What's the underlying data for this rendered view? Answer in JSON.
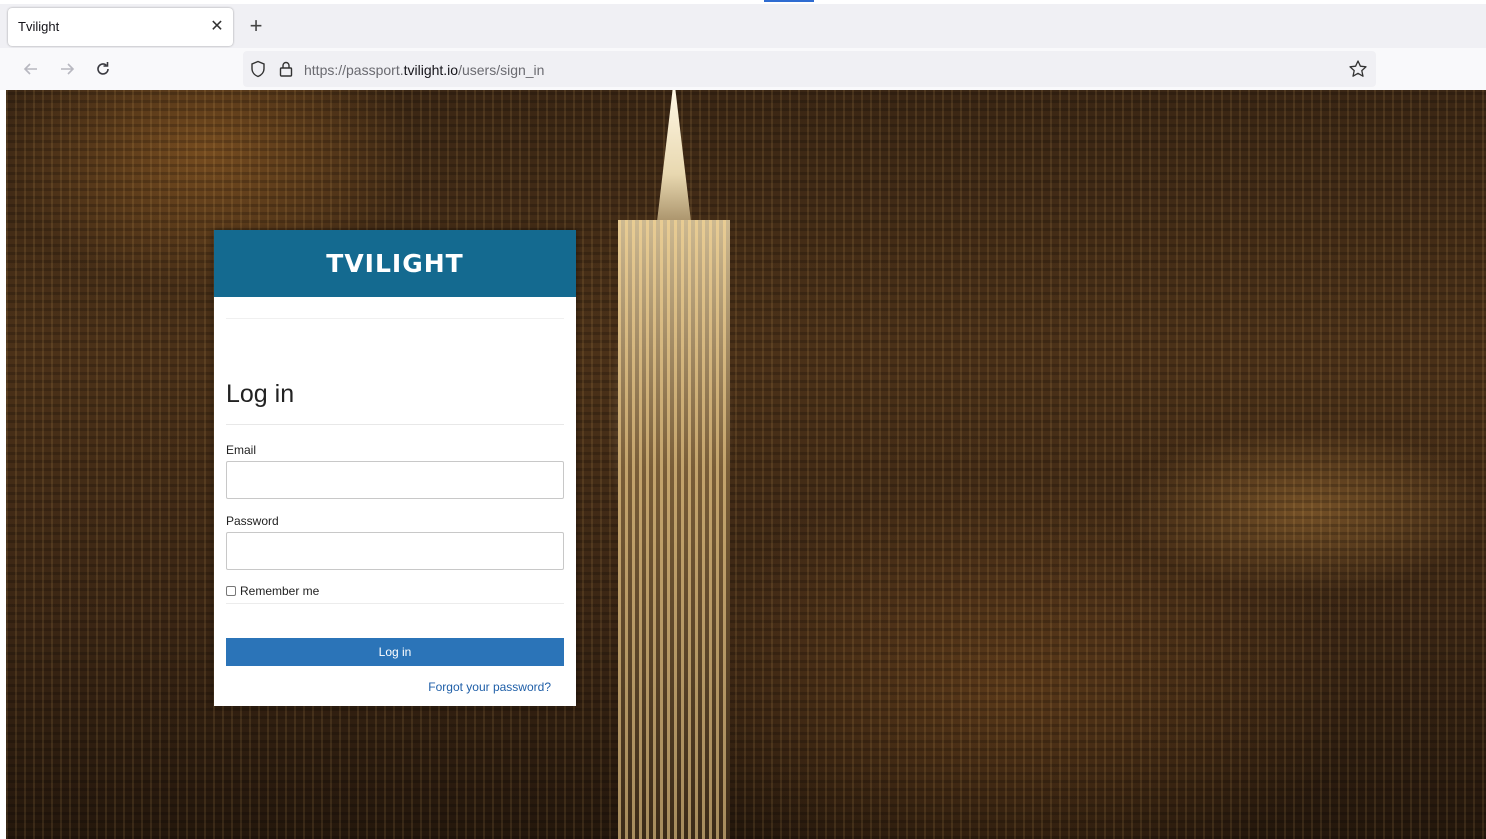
{
  "browser": {
    "tab_title": "Tvilight",
    "url_prefix": "https://passport.",
    "url_domain": "tvilight.io",
    "url_path": "/users/sign_in"
  },
  "icons": {
    "back": "back-arrow-icon",
    "forward": "forward-arrow-icon",
    "reload": "reload-icon",
    "shield": "shield-icon",
    "lock": "lock-icon",
    "bookmark": "star-icon",
    "close_tab": "close-icon",
    "new_tab": "plus-icon"
  },
  "login": {
    "brand": "TVILIGHT",
    "heading": "Log in",
    "email_label": "Email",
    "email_value": "",
    "password_label": "Password",
    "password_value": "",
    "remember_label": "Remember me",
    "remember_checked": false,
    "submit_label": "Log in",
    "forgot_label": "Forgot your password?"
  },
  "colors": {
    "brand_header": "#146a90",
    "submit_button": "#2b74b8",
    "link": "#1f5fa8"
  }
}
